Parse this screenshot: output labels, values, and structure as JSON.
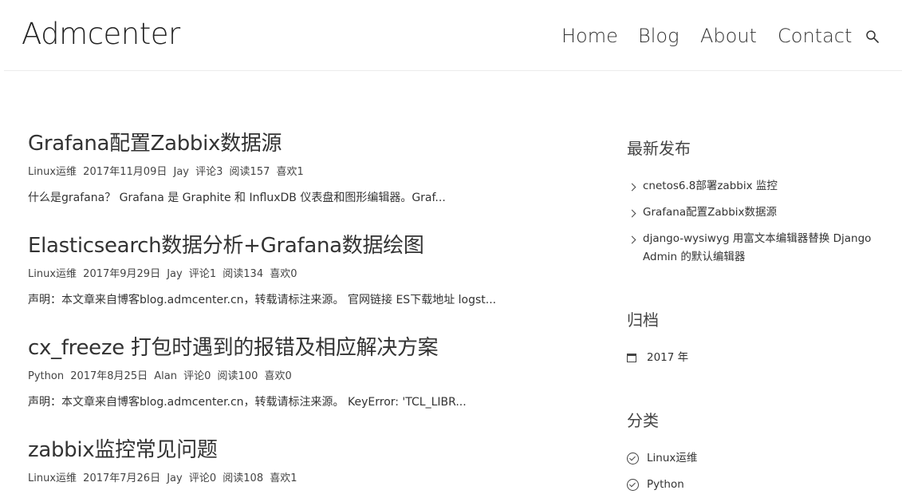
{
  "header": {
    "brand": "Admcenter",
    "nav": [
      {
        "label": "Home"
      },
      {
        "label": "Blog"
      },
      {
        "label": "About"
      },
      {
        "label": "Contact"
      }
    ],
    "search_icon": "search-icon"
  },
  "posts": [
    {
      "title": "Grafana配置Zabbix数据源",
      "category": "Linux运维",
      "date": "2017年11月09日",
      "author": "Jay",
      "comments": "评论3",
      "reads": "阅读157",
      "likes": "喜欢1",
      "excerpt": "什么是grafana？ Grafana 是 Graphite 和 InfluxDB 仪表盘和图形编辑器。Graf..."
    },
    {
      "title": "Elasticsearch数据分析+Grafana数据绘图",
      "category": "Linux运维",
      "date": "2017年9月29日",
      "author": "Jay",
      "comments": "评论1",
      "reads": "阅读134",
      "likes": "喜欢0",
      "excerpt": "声明：本文章来自博客blog.admcenter.cn，转载请标注来源。 官网链接 ES下载地址 logst..."
    },
    {
      "title": "cx_freeze 打包时遇到的报错及相应解决方案",
      "category": "Python",
      "date": "2017年8月25日",
      "author": "Alan",
      "comments": "评论0",
      "reads": "阅读100",
      "likes": "喜欢0",
      "excerpt": "声明：本文章来自博客blog.admcenter.cn，转载请标注来源。 KeyError: 'TCL_LIBR..."
    },
    {
      "title": "zabbix监控常见问题",
      "category": "Linux运维",
      "date": "2017年7月26日",
      "author": "Jay",
      "comments": "评论0",
      "reads": "阅读108",
      "likes": "喜欢1",
      "excerpt": ""
    }
  ],
  "sidebar": {
    "recent": {
      "title": "最新发布",
      "items": [
        {
          "label": "cnetos6.8部署zabbix 监控"
        },
        {
          "label": "Grafana配置Zabbix数据源"
        },
        {
          "label": "django-wysiwyg 用富文本编辑器替换 Django Admin 的默认编辑器"
        }
      ]
    },
    "archive": {
      "title": "归档",
      "items": [
        {
          "label": "2017 年"
        }
      ]
    },
    "categories": {
      "title": "分类",
      "items": [
        {
          "label": "Linux运维"
        },
        {
          "label": "Python"
        }
      ]
    }
  }
}
